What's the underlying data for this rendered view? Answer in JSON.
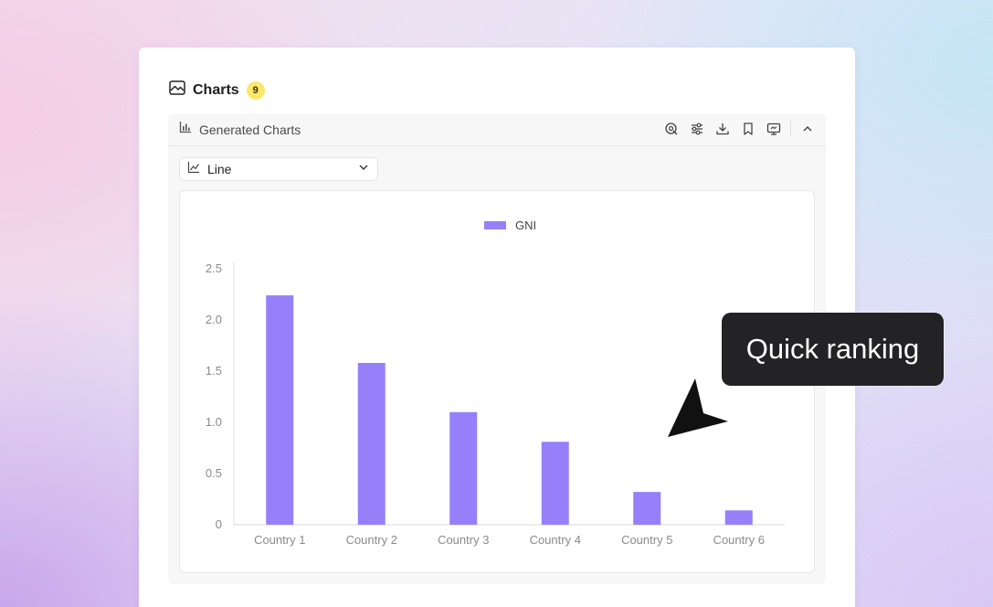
{
  "card": {
    "title": "Charts",
    "badge_count": "9"
  },
  "panel": {
    "title": "Generated Charts",
    "toolbar_icons": [
      "ai-analyze-icon",
      "settings-sliders-icon",
      "download-icon",
      "bookmark-icon",
      "present-icon",
      "collapse-chevron-icon"
    ]
  },
  "chart_type_select": {
    "value": "Line"
  },
  "tooltip": {
    "text": "Quick ranking"
  },
  "colors": {
    "bar": "#9580fa",
    "badge": "#fbe86a",
    "tooltip_bg": "#232325"
  },
  "chart_data": {
    "type": "bar",
    "categories": [
      "Country 1",
      "Country 2",
      "Country 3",
      "Country 4",
      "Country 5",
      "Country 6"
    ],
    "series": [
      {
        "name": "GNI",
        "values": [
          2.24,
          1.58,
          1.1,
          0.81,
          0.32,
          0.14
        ]
      }
    ],
    "yticks": [
      "0",
      "0.5",
      "1.0",
      "1.5",
      "2.0",
      "2.5"
    ],
    "ylim": [
      0,
      2.5
    ],
    "legend_position": "top-center",
    "grid": false
  }
}
